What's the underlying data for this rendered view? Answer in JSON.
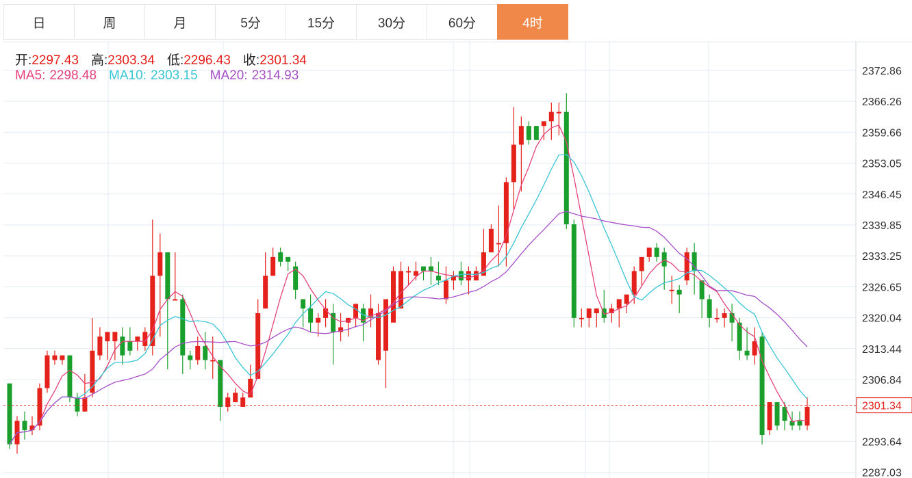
{
  "tabs": [
    {
      "label": "日",
      "active": false
    },
    {
      "label": "周",
      "active": false
    },
    {
      "label": "月",
      "active": false
    },
    {
      "label": "5分",
      "active": false
    },
    {
      "label": "15分",
      "active": false
    },
    {
      "label": "30分",
      "active": false
    },
    {
      "label": "60分",
      "active": false
    },
    {
      "label": "4时",
      "active": true
    }
  ],
  "ohlc": {
    "open_label": "开:",
    "open": "2297.43",
    "high_label": "高:",
    "high": "2303.34",
    "low_label": "低:",
    "low": "2296.43",
    "close_label": "收:",
    "close": "2301.34"
  },
  "ma": {
    "ma5_label": "MA5:",
    "ma5": "2298.48",
    "ma10_label": "MA10:",
    "ma10": "2303.15",
    "ma20_label": "MA20:",
    "ma20": "2314.93"
  },
  "colors": {
    "up": "#e5211b",
    "down": "#1a9e2c",
    "ma5": "#e6407a",
    "ma10": "#38c5d6",
    "ma20": "#a64fc8",
    "active_tab": "#f0884a",
    "grid": "#e3ebf3"
  },
  "chart_data": {
    "type": "candlestick",
    "y_ticks": [
      "2372.86",
      "2366.26",
      "2359.66",
      "2353.05",
      "2346.45",
      "2339.85",
      "2333.25",
      "2326.65",
      "2320.04",
      "2313.44",
      "2306.84",
      "2293.64",
      "2287.03"
    ],
    "ylim": [
      2287.03,
      2377.0
    ],
    "last_price": "2301.34",
    "candles": [
      [
        2306,
        2293,
        2306,
        2292
      ],
      [
        2293,
        2298,
        2299,
        2291
      ],
      [
        2298,
        2296,
        2300,
        2294
      ],
      [
        2296,
        2297,
        2299,
        2295
      ],
      [
        2297,
        2305,
        2306,
        2296
      ],
      [
        2305,
        2312,
        2313,
        2304
      ],
      [
        2311,
        2312,
        2313,
        2310
      ],
      [
        2311,
        2312,
        2312,
        2310
      ],
      [
        2312,
        2303,
        2312,
        2302
      ],
      [
        2303,
        2300,
        2304,
        2299
      ],
      [
        2300,
        2303,
        2308,
        2300
      ],
      [
        2304,
        2313,
        2320,
        2303
      ],
      [
        2312,
        2316,
        2318,
        2311
      ],
      [
        2315,
        2317,
        2317,
        2311
      ],
      [
        2315,
        2317,
        2317,
        2311
      ],
      [
        2316,
        2312,
        2318,
        2310
      ],
      [
        2315,
        2313,
        2318,
        2312
      ],
      [
        2315,
        2316,
        2316,
        2313
      ],
      [
        2314,
        2317,
        2318,
        2313
      ],
      [
        2314,
        2329,
        2341,
        2312
      ],
      [
        2329,
        2334,
        2338,
        2316
      ],
      [
        2334,
        2324,
        2334,
        2309
      ],
      [
        2324,
        2324,
        2334,
        2324
      ],
      [
        2324,
        2312,
        2325,
        2308
      ],
      [
        2312,
        2311,
        2313,
        2309
      ],
      [
        2311,
        2314,
        2316,
        2310
      ],
      [
        2314,
        2311,
        2317,
        2309
      ],
      [
        2311,
        2311,
        2316,
        2307
      ],
      [
        2311,
        2301,
        2311,
        2298
      ],
      [
        2301,
        2303,
        2304,
        2300
      ],
      [
        2302,
        2304,
        2305,
        2302
      ],
      [
        2301,
        2303,
        2304,
        2301
      ],
      [
        2303,
        2307,
        2310,
        2303
      ],
      [
        2307,
        2321,
        2324,
        2307
      ],
      [
        2322,
        2329,
        2334,
        2322
      ],
      [
        2329,
        2333,
        2335,
        2329
      ],
      [
        2334,
        2332,
        2335,
        2331
      ],
      [
        2333,
        2332,
        2333,
        2330
      ],
      [
        2331,
        2326,
        2332,
        2324
      ],
      [
        2324,
        2322,
        2324,
        2318
      ],
      [
        2322,
        2319,
        2325,
        2317
      ],
      [
        2319,
        2320,
        2321,
        2316
      ],
      [
        2320,
        2322,
        2324,
        2318
      ],
      [
        2321,
        2317,
        2323,
        2310
      ],
      [
        2317,
        2318,
        2321,
        2315
      ],
      [
        2319,
        2320,
        2320,
        2316
      ],
      [
        2320,
        2323,
        2322,
        2318
      ],
      [
        2322,
        2319,
        2323,
        2315
      ],
      [
        2320,
        2322,
        2325,
        2318
      ],
      [
        2311,
        2321,
        2323,
        2310
      ],
      [
        2313,
        2324,
        2324,
        2305
      ],
      [
        2319,
        2330,
        2331,
        2324
      ],
      [
        2322,
        2330,
        2332,
        2325
      ],
      [
        2330,
        2330,
        2331,
        2327
      ],
      [
        2329,
        2330,
        2332,
        2328
      ],
      [
        2331,
        2330,
        2331,
        2328
      ],
      [
        2331,
        2330,
        2333,
        2327
      ],
      [
        2329,
        2328,
        2332,
        2327
      ],
      [
        2324,
        2328,
        2331,
        2323
      ],
      [
        2328,
        2329,
        2330,
        2326
      ],
      [
        2330,
        2328,
        2332,
        2327
      ],
      [
        2328,
        2330,
        2331,
        2325
      ],
      [
        2328,
        2330,
        2331,
        2328
      ],
      [
        2329,
        2334,
        2339,
        2329
      ],
      [
        2334,
        2339,
        2340,
        2334
      ],
      [
        2336,
        2336,
        2344,
        2331
      ],
      [
        2336,
        2349,
        2350,
        2331
      ],
      [
        2349,
        2357,
        2365,
        2343
      ],
      [
        2357,
        2361,
        2363,
        2347
      ],
      [
        2361,
        2358,
        2362,
        2357
      ],
      [
        2361,
        2358,
        2361,
        2358
      ],
      [
        2361,
        2362,
        2362,
        2358
      ],
      [
        2362,
        2364,
        2366,
        2358
      ],
      [
        2364,
        2364,
        2366,
        2359
      ],
      [
        2364,
        2340,
        2368,
        2339
      ],
      [
        2340,
        2320,
        2341,
        2318
      ],
      [
        2320,
        2320,
        2322,
        2318
      ],
      [
        2320,
        2322,
        2322,
        2318
      ],
      [
        2321,
        2322,
        2322,
        2318
      ],
      [
        2322,
        2320,
        2326,
        2319
      ],
      [
        2321,
        2322,
        2323,
        2319
      ],
      [
        2322,
        2324,
        2324,
        2318
      ],
      [
        2323,
        2325,
        2324,
        2321
      ],
      [
        2325,
        2330,
        2331,
        2323
      ],
      [
        2330,
        2333,
        2333,
        2327
      ],
      [
        2333,
        2335,
        2335,
        2332
      ],
      [
        2335,
        2333,
        2336,
        2332
      ],
      [
        2334,
        2331,
        2335,
        2326
      ],
      [
        2326,
        2326,
        2329,
        2323
      ],
      [
        2326,
        2325,
        2327,
        2321
      ],
      [
        2328,
        2334,
        2335,
        2327
      ],
      [
        2334,
        2330,
        2336,
        2325
      ],
      [
        2328,
        2324,
        2328,
        2320
      ],
      [
        2324,
        2320,
        2325,
        2318
      ],
      [
        2320,
        2320,
        2322,
        2319
      ],
      [
        2320,
        2321,
        2322,
        2318
      ],
      [
        2321,
        2319,
        2323,
        2315
      ],
      [
        2319,
        2313,
        2320,
        2311
      ],
      [
        2313,
        2312,
        2318,
        2311
      ],
      [
        2312,
        2315,
        2318,
        2310
      ],
      [
        2316,
        2295,
        2317,
        2293
      ],
      [
        2296,
        2302,
        2302,
        2295
      ],
      [
        2302,
        2297,
        2302,
        2296
      ],
      [
        2301,
        2298,
        2302,
        2296
      ],
      [
        2298,
        2297,
        2300,
        2296
      ],
      [
        2298,
        2297,
        2300,
        2296
      ],
      [
        2297,
        2301,
        2303,
        2296
      ]
    ]
  }
}
